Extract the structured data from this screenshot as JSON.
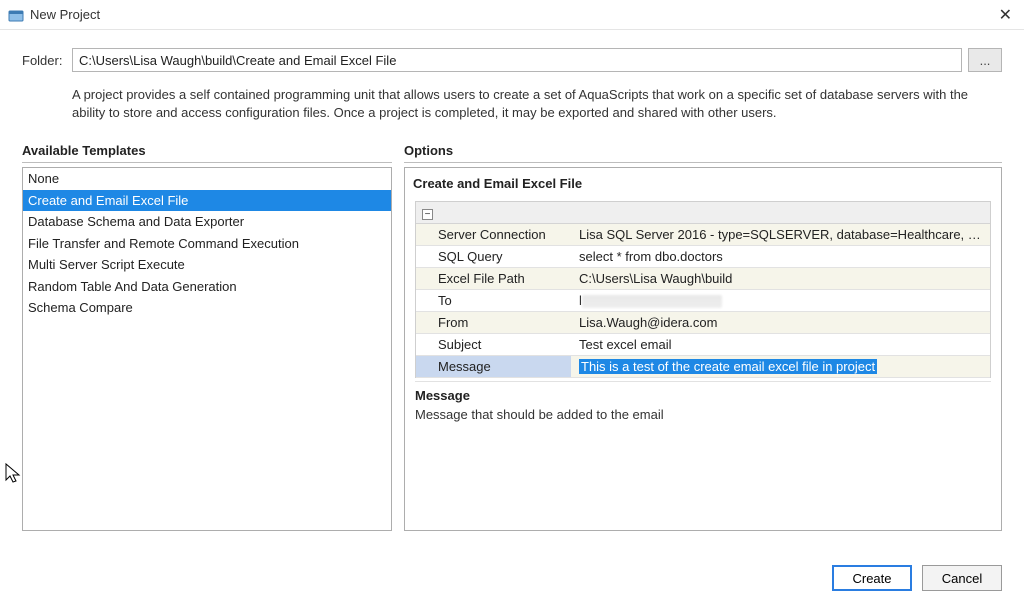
{
  "window": {
    "title": "New Project",
    "close": "✕"
  },
  "folder": {
    "label": "Folder:",
    "value": "C:\\Users\\Lisa Waugh\\build\\Create and Email Excel File",
    "browse": "..."
  },
  "description": "A project provides a self contained programming unit that allows users to create a set of AquaScripts that work on a specific set of database servers with the ability to store and access configuration files.  Once a project is completed, it may be exported and shared with other users.",
  "templates": {
    "header": "Available Templates",
    "items": [
      "None",
      "Create and Email Excel File",
      "Database Schema and Data Exporter",
      "File Transfer and Remote Command Execution",
      "Multi Server Script Execute",
      "Random Table And Data Generation",
      "Schema Compare"
    ],
    "selected_index": 1
  },
  "options": {
    "header": "Options",
    "title": "Create and Email Excel File",
    "rows": [
      {
        "key": "Server Connection",
        "value": "Lisa SQL Server 2016 - type=SQLSERVER, database=Healthcare, s..."
      },
      {
        "key": "SQL Query",
        "value": "select * from dbo.doctors"
      },
      {
        "key": "Excel File Path",
        "value": "C:\\Users\\Lisa Waugh\\build"
      },
      {
        "key": "To",
        "value": "",
        "redacted": true,
        "prefix": "l"
      },
      {
        "key": "From",
        "value": "Lisa.Waugh@idera.com"
      },
      {
        "key": "Subject",
        "value": "Test excel email"
      },
      {
        "key": "Message",
        "value": "This is a test of the create email excel file in project",
        "selected": true,
        "highlight": true
      }
    ],
    "detail_label": "Message",
    "detail_text": "Message that should be added to the email"
  },
  "buttons": {
    "create": "Create",
    "cancel": "Cancel"
  }
}
